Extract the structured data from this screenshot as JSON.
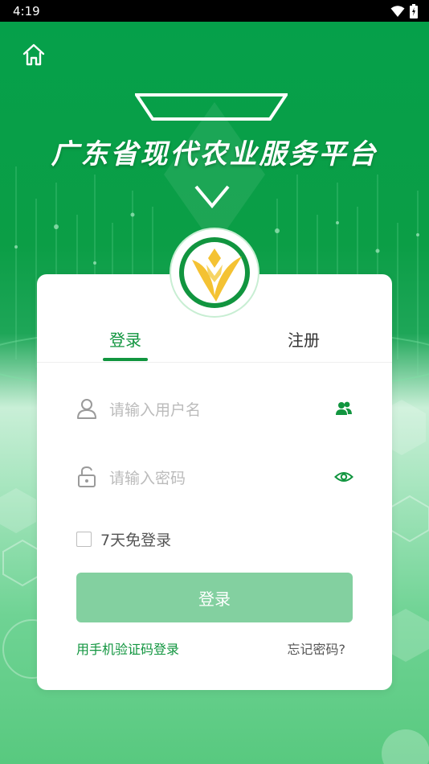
{
  "status_bar": {
    "time": "4:19"
  },
  "header": {
    "title": "广东省现代农业服务平台"
  },
  "tabs": [
    {
      "label": "登录",
      "active": true
    },
    {
      "label": "注册",
      "active": false
    }
  ],
  "form": {
    "username_placeholder": "请输入用户名",
    "password_placeholder": "请输入密码",
    "remember_label": "7天免登录",
    "login_button": "登录",
    "sms_login_link": "用手机验证码登录",
    "forgot_password_link": "忘记密码?"
  },
  "colors": {
    "brand_green": "#11953f",
    "button_disabled": "#83d0a0",
    "hero_green": "#05a04a",
    "logo_yellow": "#f4c233"
  },
  "icons": [
    "home-icon",
    "wifi-icon",
    "battery-icon",
    "user-icon",
    "contacts-icon",
    "lock-icon",
    "eye-icon"
  ]
}
